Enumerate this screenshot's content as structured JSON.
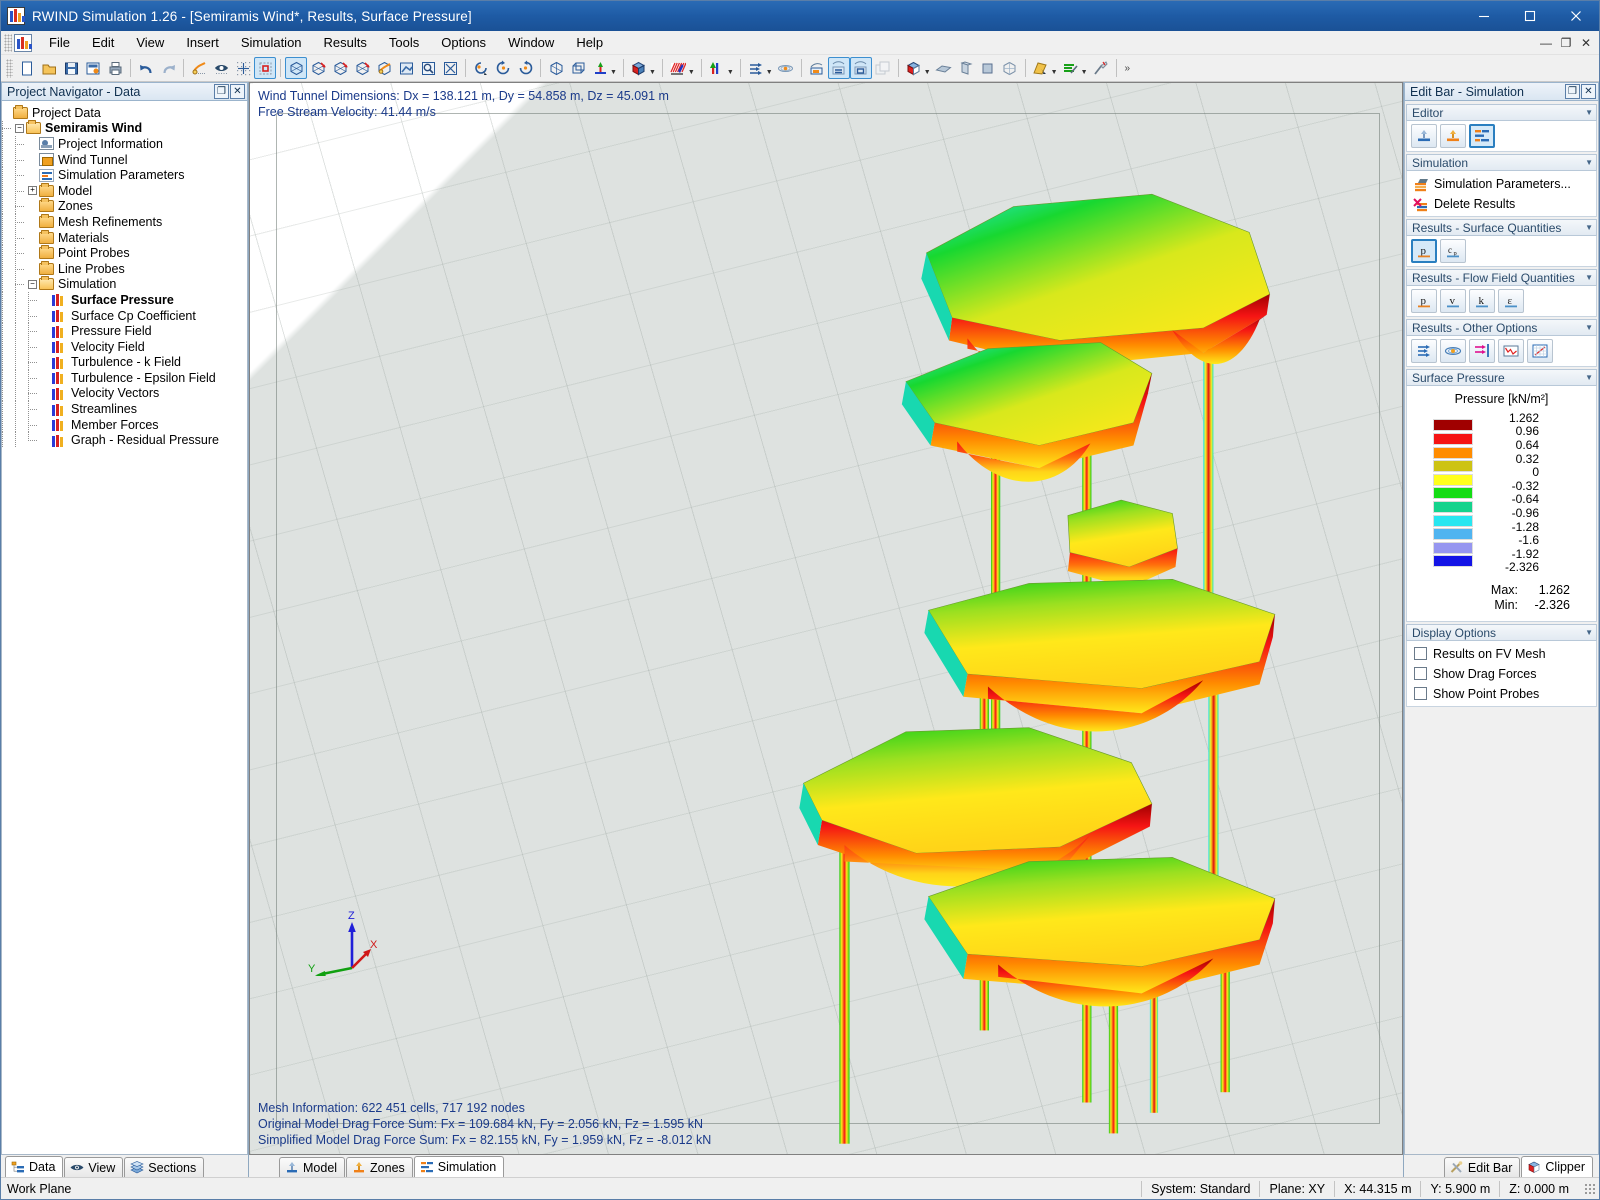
{
  "window": {
    "title": "RWIND Simulation 1.26 - [Semiramis Wind*, Results, Surface Pressure]",
    "app_icon": "rwind-app-icon",
    "minimize": "minimize-button",
    "maximize": "maximize-button",
    "close": "close-button"
  },
  "menubar": {
    "items": [
      "File",
      "Edit",
      "View",
      "Insert",
      "Simulation",
      "Results",
      "Tools",
      "Options",
      "Window",
      "Help"
    ],
    "mdi": {
      "minimize": "—",
      "restore": "❐",
      "close": "✕"
    }
  },
  "toolbar": {
    "groups": [
      {
        "buttons": [
          {
            "name": "new-icon",
            "state": "normal"
          },
          {
            "name": "open-folder-icon",
            "state": "normal"
          },
          {
            "name": "save-icon",
            "state": "normal"
          },
          {
            "name": "save-as-icon",
            "state": "normal"
          },
          {
            "name": "print-icon",
            "state": "normal"
          }
        ]
      },
      {
        "buttons": [
          {
            "name": "undo-icon",
            "state": "normal"
          },
          {
            "name": "redo-icon",
            "state": "disabled"
          }
        ]
      },
      {
        "buttons": [
          {
            "name": "render-selection-icon",
            "state": "normal"
          },
          {
            "name": "visibility-eye-icon",
            "state": "normal"
          },
          {
            "name": "snap-grid-icon",
            "state": "normal"
          },
          {
            "name": "selection-window-icon",
            "state": "active"
          }
        ]
      },
      {
        "buttons": [
          {
            "name": "view-iso-icon",
            "state": "active"
          },
          {
            "name": "view-x-icon",
            "state": "normal"
          },
          {
            "name": "view-y-icon",
            "state": "normal"
          },
          {
            "name": "view-z-icon",
            "state": "normal"
          },
          {
            "name": "render-mode-icon",
            "state": "normal"
          },
          {
            "name": "zoom-window-icon",
            "state": "normal"
          },
          {
            "name": "zoom-lens-icon",
            "state": "normal"
          },
          {
            "name": "zoom-all-icon",
            "state": "normal"
          }
        ]
      },
      {
        "buttons": [
          {
            "name": "rotate-pick-icon",
            "state": "normal"
          },
          {
            "name": "rotate-ccw-icon",
            "state": "normal"
          },
          {
            "name": "rotate-cw-icon",
            "state": "normal"
          }
        ]
      },
      {
        "buttons": [
          {
            "name": "wireframe-icon",
            "state": "normal"
          },
          {
            "name": "perspective-icon",
            "state": "normal"
          },
          {
            "name": "axis-color-icon",
            "state": "normal",
            "dropdown": true
          }
        ]
      },
      {
        "buttons": [
          {
            "name": "solid-cube-icon",
            "state": "normal",
            "dropdown": true
          }
        ]
      },
      {
        "buttons": [
          {
            "name": "hatch-style-icon",
            "state": "normal",
            "dropdown": true
          }
        ]
      },
      {
        "buttons": [
          {
            "name": "colors-icon",
            "state": "normal",
            "dropdown": true
          }
        ]
      },
      {
        "buttons": [
          {
            "name": "flow-arrows-icon",
            "state": "normal",
            "dropdown": true
          },
          {
            "name": "streamline-icon",
            "state": "normal"
          }
        ]
      },
      {
        "buttons": [
          {
            "name": "result-box-icon",
            "state": "normal"
          },
          {
            "name": "result-surface-icon",
            "state": "active"
          },
          {
            "name": "result-section-icon",
            "state": "active"
          },
          {
            "name": "result-copy-icon",
            "state": "disabled"
          }
        ]
      },
      {
        "buttons": [
          {
            "name": "clipper-cube-icon",
            "state": "normal",
            "dropdown": true
          },
          {
            "name": "plane-icon",
            "state": "normal"
          },
          {
            "name": "slab-icon",
            "state": "normal"
          },
          {
            "name": "fill-icon",
            "state": "normal"
          },
          {
            "name": "mesh-box-icon",
            "state": "normal"
          }
        ]
      },
      {
        "buttons": [
          {
            "name": "measure-pick-icon",
            "state": "normal",
            "dropdown": true
          },
          {
            "name": "settings-tools-icon",
            "state": "normal",
            "dropdown": true
          },
          {
            "name": "cleanup-icon",
            "state": "normal"
          }
        ]
      }
    ],
    "overflow_label": "»"
  },
  "navigator": {
    "caption": "Project Navigator - Data",
    "pin": "❐",
    "close": "✕",
    "tree": [
      {
        "label": "Project Data",
        "depth": 0,
        "icon": "folder",
        "bold": false,
        "expander": ""
      },
      {
        "label": "Semiramis Wind",
        "depth": 1,
        "icon": "folder-open",
        "bold": true,
        "expander": "minus"
      },
      {
        "label": "Project Information",
        "depth": 2,
        "icon": "doc",
        "bold": false,
        "expander": ""
      },
      {
        "label": "Wind Tunnel",
        "depth": 2,
        "icon": "cube",
        "bold": false,
        "expander": ""
      },
      {
        "label": "Simulation Parameters",
        "depth": 2,
        "icon": "bars",
        "bold": false,
        "expander": ""
      },
      {
        "label": "Model",
        "depth": 2,
        "icon": "folder",
        "bold": false,
        "expander": "plus"
      },
      {
        "label": "Zones",
        "depth": 2,
        "icon": "folder",
        "bold": false,
        "expander": ""
      },
      {
        "label": "Mesh Refinements",
        "depth": 2,
        "icon": "folder",
        "bold": false,
        "expander": ""
      },
      {
        "label": "Materials",
        "depth": 2,
        "icon": "folder",
        "bold": false,
        "expander": ""
      },
      {
        "label": "Point Probes",
        "depth": 2,
        "icon": "folder",
        "bold": false,
        "expander": ""
      },
      {
        "label": "Line Probes",
        "depth": 2,
        "icon": "folder",
        "bold": false,
        "expander": ""
      },
      {
        "label": "Simulation",
        "depth": 2,
        "icon": "folder-open",
        "bold": false,
        "expander": "minus"
      },
      {
        "label": "Surface Pressure",
        "depth": 3,
        "icon": "res",
        "bold": true,
        "expander": ""
      },
      {
        "label": "Surface Cp Coefficient",
        "depth": 3,
        "icon": "res",
        "bold": false,
        "expander": ""
      },
      {
        "label": "Pressure Field",
        "depth": 3,
        "icon": "res",
        "bold": false,
        "expander": ""
      },
      {
        "label": "Velocity Field",
        "depth": 3,
        "icon": "res",
        "bold": false,
        "expander": ""
      },
      {
        "label": "Turbulence - k Field",
        "depth": 3,
        "icon": "res",
        "bold": false,
        "expander": ""
      },
      {
        "label": "Turbulence - Epsilon Field",
        "depth": 3,
        "icon": "res",
        "bold": false,
        "expander": ""
      },
      {
        "label": "Velocity Vectors",
        "depth": 3,
        "icon": "res",
        "bold": false,
        "expander": ""
      },
      {
        "label": "Streamlines",
        "depth": 3,
        "icon": "res",
        "bold": false,
        "expander": ""
      },
      {
        "label": "Member Forces",
        "depth": 3,
        "icon": "res",
        "bold": false,
        "expander": ""
      },
      {
        "label": "Graph - Residual Pressure",
        "depth": 3,
        "icon": "res",
        "bold": false,
        "expander": ""
      }
    ]
  },
  "left_tabs": [
    {
      "label": "Data",
      "icon": "data-tree-icon",
      "selected": true
    },
    {
      "label": "View",
      "icon": "eye-icon",
      "selected": false
    },
    {
      "label": "Sections",
      "icon": "layers-icon",
      "selected": false
    }
  ],
  "viewport": {
    "overlay_top": [
      "Wind Tunnel Dimensions: Dx = 138.121 m, Dy = 54.858 m, Dz = 45.091 m",
      "Free Stream Velocity: 41.44 m/s"
    ],
    "overlay_bottom": [
      "Mesh Information: 622 451 cells, 717 192 nodes",
      "Original Model Drag Force Sum: Fx = 109.684 kN, Fy = 2.056 kN, Fz = 1.595 kN",
      "Simplified Model Drag Force Sum: Fx = 82.155 kN, Fy = 1.959 kN, Fz = -8.012 kN"
    ],
    "axis": {
      "x": "X",
      "y": "Y",
      "z": "Z",
      "x_color": "#d01818",
      "y_color": "#10a010",
      "z_color": "#2020d8"
    },
    "overlay_color": "#1a3a8a"
  },
  "bottom_tabs": [
    {
      "label": "Model",
      "icon": "model-icon",
      "selected": false
    },
    {
      "label": "Zones",
      "icon": "zones-icon",
      "selected": false
    },
    {
      "label": "Simulation",
      "icon": "simulation-icon",
      "selected": true
    }
  ],
  "editbar": {
    "caption": "Edit Bar - Simulation",
    "pin": "❐",
    "close": "✕",
    "groups": [
      {
        "title": "Editor",
        "kind": "buttons",
        "buttons": [
          {
            "name": "model-editor-icon",
            "selected": false
          },
          {
            "name": "zones-editor-icon",
            "selected": false
          },
          {
            "name": "simulation-editor-icon",
            "selected": true
          }
        ]
      },
      {
        "title": "Simulation",
        "kind": "commands",
        "commands": [
          {
            "label": "Simulation Parameters...",
            "icon": "sim-parameters-icon"
          },
          {
            "label": "Delete Results",
            "icon": "delete-results-icon"
          }
        ]
      },
      {
        "title": "Results - Surface Quantities",
        "kind": "buttons",
        "buttons": [
          {
            "name": "surface-pressure-p-icon",
            "glyph": "p",
            "selected": true
          },
          {
            "name": "surface-cp-icon",
            "glyph": "cp",
            "selected": false
          }
        ]
      },
      {
        "title": "Results - Flow Field Quantities",
        "kind": "buttons",
        "buttons": [
          {
            "name": "flow-pressure-p-icon",
            "glyph": "p",
            "selected": false
          },
          {
            "name": "flow-velocity-v-icon",
            "glyph": "v",
            "selected": false
          },
          {
            "name": "flow-turbulence-k-icon",
            "glyph": "k",
            "selected": false
          },
          {
            "name": "flow-turbulence-epsilon-icon",
            "glyph": "ε",
            "selected": false
          }
        ]
      },
      {
        "title": "Results - Other Options",
        "kind": "buttons",
        "buttons": [
          {
            "name": "velocity-vectors-icon",
            "selected": false
          },
          {
            "name": "streamlines-icon",
            "selected": false
          },
          {
            "name": "member-forces-icon",
            "selected": false
          },
          {
            "name": "residual-graph-icon",
            "selected": false
          },
          {
            "name": "diagram-icon",
            "selected": false
          }
        ]
      }
    ],
    "legend": {
      "title": "Surface Pressure",
      "header": "Pressure [kN/m²]",
      "max_label": "Max:",
      "min_label": "Min:",
      "max_value": "1.262",
      "min_value": "-2.326"
    },
    "display_options": {
      "title": "Display Options",
      "items": [
        {
          "label": "Results on FV Mesh",
          "checked": false
        },
        {
          "label": "Show Drag Forces",
          "checked": false
        },
        {
          "label": "Show Point Probes",
          "checked": false
        }
      ]
    }
  },
  "right_tabs": [
    {
      "label": "Edit Bar",
      "icon": "tools-icon",
      "selected": false
    },
    {
      "label": "Clipper",
      "icon": "clipper-icon",
      "selected": true
    }
  ],
  "statusbar": {
    "left": "Work Plane",
    "cells": [
      "System: Standard",
      "Plane: XY",
      "X:  44.315 m",
      "Y:  5.900 m",
      "Z:  0.000 m"
    ]
  },
  "chart_data": {
    "type": "heatmap",
    "title": "Surface Pressure",
    "unit": "kN/m²",
    "legend_header": "Pressure [kN/m²]",
    "values": [
      1.262,
      0.96,
      0.64,
      0.32,
      0.0,
      -0.32,
      -0.64,
      -0.96,
      -1.28,
      -1.6,
      -1.92,
      -2.326
    ],
    "colors": [
      "#a00000",
      "#f51414",
      "#ff8c00",
      "#cdc314",
      "#ffff1e",
      "#14dc14",
      "#14d38c",
      "#28e6f0",
      "#50b4f0",
      "#9696f0",
      "#1414e6"
    ],
    "max": 1.262,
    "min": -2.326,
    "mesh_cells": 622451,
    "mesh_nodes": 717192,
    "wind_tunnel": {
      "Dx": 138.121,
      "Dy": 54.858,
      "Dz": 45.091,
      "unit": "m"
    },
    "free_stream_velocity": 41.44,
    "free_stream_velocity_unit": "m/s",
    "original_model_drag": {
      "Fx": 109.684,
      "Fy": 2.056,
      "Fz": 1.595,
      "unit": "kN"
    },
    "simplified_model_drag": {
      "Fx": 82.155,
      "Fy": 1.959,
      "Fz": -8.012,
      "unit": "kN"
    }
  }
}
